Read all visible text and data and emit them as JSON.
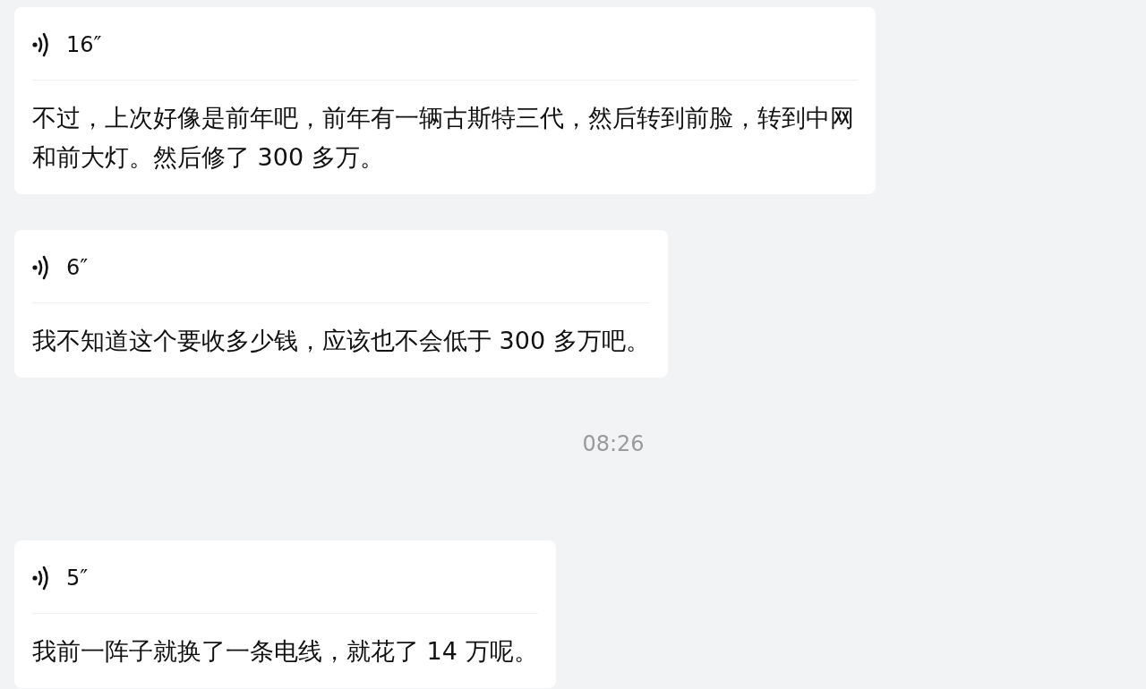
{
  "messages": [
    {
      "kind": "voice",
      "duration": "16″",
      "transcript": "不过，上次好像是前年吧，前年有一辆古斯特三代，然后转到前脸，转到中网和前大灯。然后修了 300 多万。"
    },
    {
      "kind": "voice",
      "duration": "6″",
      "transcript": "我不知道这个要收多少钱，应该也不会低于 300 多万吧。"
    },
    {
      "kind": "time",
      "text": "08:26"
    },
    {
      "kind": "voice",
      "duration": "5″",
      "transcript": "我前一阵子就换了一条电线，就花了 14 万呢。"
    }
  ]
}
